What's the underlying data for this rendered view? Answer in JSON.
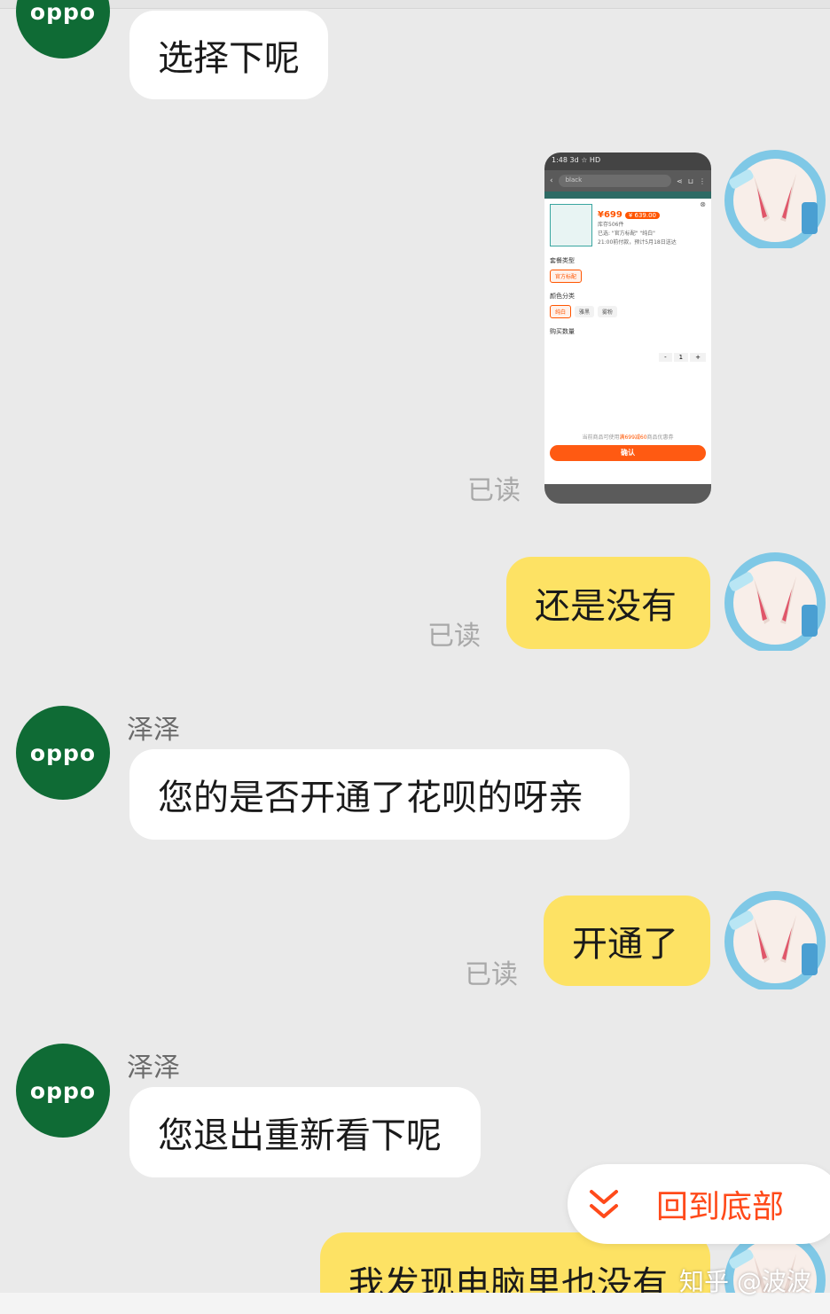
{
  "agent": {
    "avatar_text": "oppo",
    "name": "泽泽"
  },
  "read_label": "已读",
  "messages": [
    {
      "side": "left",
      "text": "选择下呢"
    },
    {
      "side": "right",
      "type": "image"
    },
    {
      "side": "right",
      "text": "还是没有"
    },
    {
      "side": "left",
      "text": "您的是否开通了花呗的呀亲"
    },
    {
      "side": "right",
      "text": "开通了"
    },
    {
      "side": "left",
      "text": "您退出重新看下呢"
    },
    {
      "side": "right",
      "text": "我发现电脑里也没有"
    }
  ],
  "screenshot": {
    "status": "1:48 3d ☆ HD",
    "search_placeholder": "black",
    "price": "¥699",
    "coupon_price": "¥ 639.00",
    "stock": "库存506件",
    "selected": "已选: \"官方标配\" \"纯白\"",
    "delivery": "21:00前付款，预计5月18日送达",
    "package_label": "套餐类型",
    "package_option": "官方标配",
    "color_label": "颜色分类",
    "color_options": [
      "纯白",
      "雅黑",
      "雾粉"
    ],
    "qty_label": "购买数量",
    "qty_value": "1",
    "coupon_note_prefix": "当前商品可使用",
    "coupon_note_highlight": "满699减60",
    "coupon_note_suffix": "商品优惠券",
    "confirm": "确认"
  },
  "back_to_bottom": "回到底部",
  "watermark": "知乎 @波波",
  "colors": {
    "agent_green": "#0f6b35",
    "user_bubble": "#fde264",
    "accent": "#ff4a1a"
  }
}
